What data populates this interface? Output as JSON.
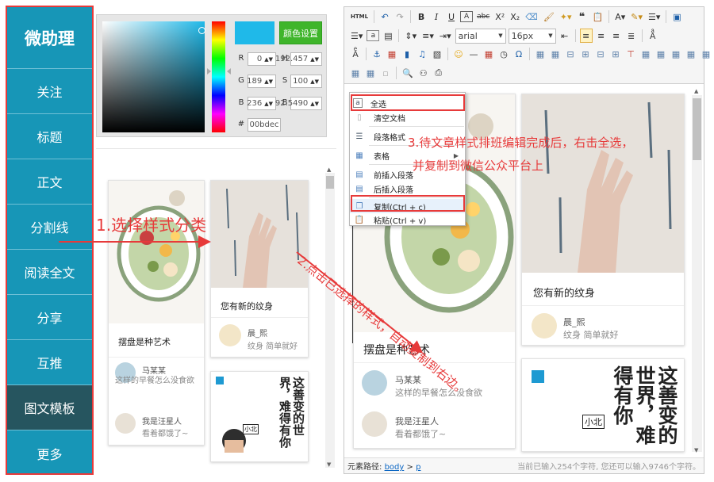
{
  "sidebar": {
    "logo": "微助理",
    "items": [
      {
        "label": "关注"
      },
      {
        "label": "标题"
      },
      {
        "label": "正文"
      },
      {
        "label": "分割线"
      },
      {
        "label": "阅读全文"
      },
      {
        "label": "分享"
      },
      {
        "label": "互推"
      },
      {
        "label": "图文模板",
        "active": true
      },
      {
        "label": "更多"
      }
    ]
  },
  "color_picker": {
    "selected_color": "#1fb9e9",
    "set_button": "颜色设置",
    "fields": {
      "r_label": "R",
      "r_value": "0",
      "g_label": "G",
      "g_value": "189",
      "b_label": "B",
      "b_value": "236",
      "h_label": "H",
      "h_value": "192.457",
      "s_label": "S",
      "s_value": "100",
      "br_label": "B",
      "br_value": "92.5490",
      "hex_label": "#",
      "hex_value": "00bdec"
    }
  },
  "cards": {
    "card1": {
      "title": "摆盘是种艺术"
    },
    "card2": {
      "title": "您有新的纹身",
      "commenter": "晨_熙",
      "comment": "纹身 简单就好"
    },
    "comments": [
      {
        "name": "马某某",
        "text": "这样的早餐怎么没食欲"
      },
      {
        "name": "我是汪星人",
        "text": "看着都饿了~"
      }
    ],
    "book": {
      "title_text": "这善变的世界，难得有你",
      "author": "小北"
    }
  },
  "context_menu": {
    "items": [
      {
        "label": "全选",
        "icon": "select-all-icon",
        "boxed": true
      },
      {
        "label": "清空文档",
        "icon": "clear-doc-icon"
      },
      {
        "label": "段落格式",
        "icon": "paragraph-icon"
      },
      {
        "label": "表格",
        "icon": "table-icon",
        "submenu": true
      },
      {
        "label": "前插入段落",
        "icon": "insert-before-icon"
      },
      {
        "label": "后插入段落",
        "icon": "insert-after-icon"
      },
      {
        "label": "复制(Ctrl + c)",
        "icon": "copy-icon",
        "boxed": true
      },
      {
        "label": "粘贴(Ctrl + v)",
        "icon": "paste-icon"
      }
    ]
  },
  "editor": {
    "font_name": "arial",
    "font_size": "16px",
    "status_path_label": "元素路径:",
    "status_path_body": "body",
    "status_path_sep": ">",
    "status_path_p": "p",
    "char_count_text": "当前已输入254个字符, 您还可以输入9746个字符。"
  },
  "annotations": {
    "step1": "1.选择样式分类",
    "step2": "2.点击已选择的样式，自动复制到右边。",
    "step3_line1": "3.待文章样式排班编辑完成后，右击全选，",
    "step3_line2": "并复制到微信公众平台上"
  },
  "colors": {
    "sidebar": "#1796b7",
    "sidebar_active": "#26555f",
    "annotation": "#e73a3a",
    "accent_green": "#3fb52b"
  }
}
